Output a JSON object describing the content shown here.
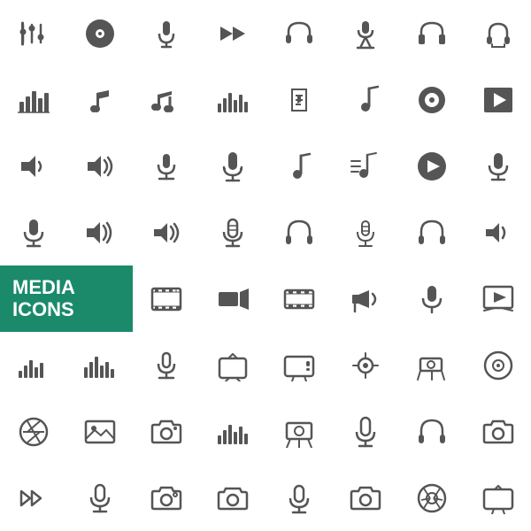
{
  "title": "Media Icons",
  "label_line1": "MEDIA",
  "label_line2": "ICONS",
  "accent_color": "#1a8a6a",
  "icon_color": "#555555"
}
